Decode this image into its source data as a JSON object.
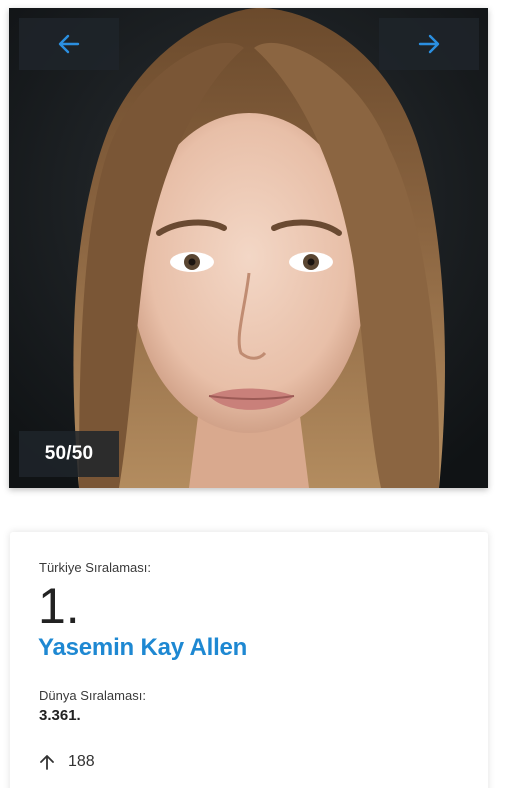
{
  "gallery": {
    "counter": "50/50",
    "prev_icon": "arrow-left-icon",
    "next_icon": "arrow-right-icon",
    "accent_color": "#1e88d2"
  },
  "ranking": {
    "turkey_label": "Türkiye Sıralaması:",
    "turkey_rank": "1.",
    "name": "Yasemin Kay Allen",
    "world_label": "Dünya Sıralaması:",
    "world_rank": "3.361.",
    "change_icon": "arrow-up-icon",
    "change_value": "188"
  }
}
